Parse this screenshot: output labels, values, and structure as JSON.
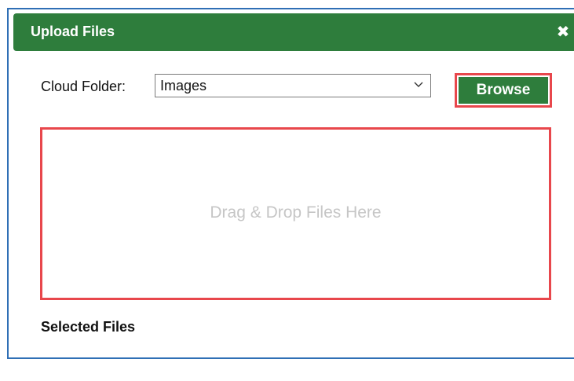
{
  "dialog": {
    "title": "Upload Files",
    "close_glyph": "✖",
    "colors": {
      "header_bg": "#2e7d3c",
      "header_text": "#ffffff",
      "highlight_border": "#e8474c",
      "dropzone_text": "#c6c6c6",
      "frame": "#2f6fb5"
    }
  },
  "folder": {
    "label": "Cloud Folder:",
    "selected": "Images"
  },
  "browse": {
    "label": "Browse"
  },
  "dropzone": {
    "text": "Drag & Drop Files Here"
  },
  "selected_files": {
    "title": "Selected Files",
    "items": []
  },
  "icons": {
    "close": "close-icon",
    "chevron": "chevron-down-icon"
  }
}
